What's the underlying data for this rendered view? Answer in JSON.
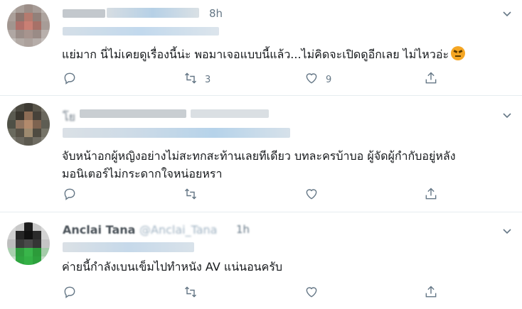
{
  "tweets": [
    {
      "time": "8h",
      "text_parts": [
        "แย่มาก นี่ไม่เคยดูเรื่องนี้น่ะ พอมาเจอแบบนี้แล้ว...ไม่คิดจะเปิดดูอีกเลย ไม่ไหวอ่ะ"
      ],
      "emoji": "angry-face-emoji",
      "replies": "",
      "retweets": "3",
      "likes": "9"
    },
    {
      "time": "",
      "name": "โย",
      "text_parts": [
        "จับหน้าอกผู้หญิงอย่างไม่สะทกสะท้านเลยทีเดียว บทละครบ้าบอ ผู้จัดผู้กำกับอยู่หลัง",
        "มอนิเตอร์ไม่กระดากใจหน่อยหรา"
      ],
      "replies": "",
      "retweets": "",
      "likes": ""
    },
    {
      "time": "1h",
      "name": "Anclai Tana",
      "handle": "@Anclai_Tana",
      "text_parts": [
        "ค่ายนี้กำลังเบนเข็มไปทำหนัง AV แน่นอนครับ"
      ],
      "replies": "",
      "retweets": "",
      "likes": ""
    }
  ],
  "icons": {
    "menu": "chevron-down-icon",
    "reply": "reply-icon",
    "retweet": "retweet-icon",
    "like": "heart-icon",
    "share": "share-icon"
  },
  "colors": {
    "text": "#14171a",
    "muted": "#657786",
    "divider": "#e6ecf0"
  }
}
